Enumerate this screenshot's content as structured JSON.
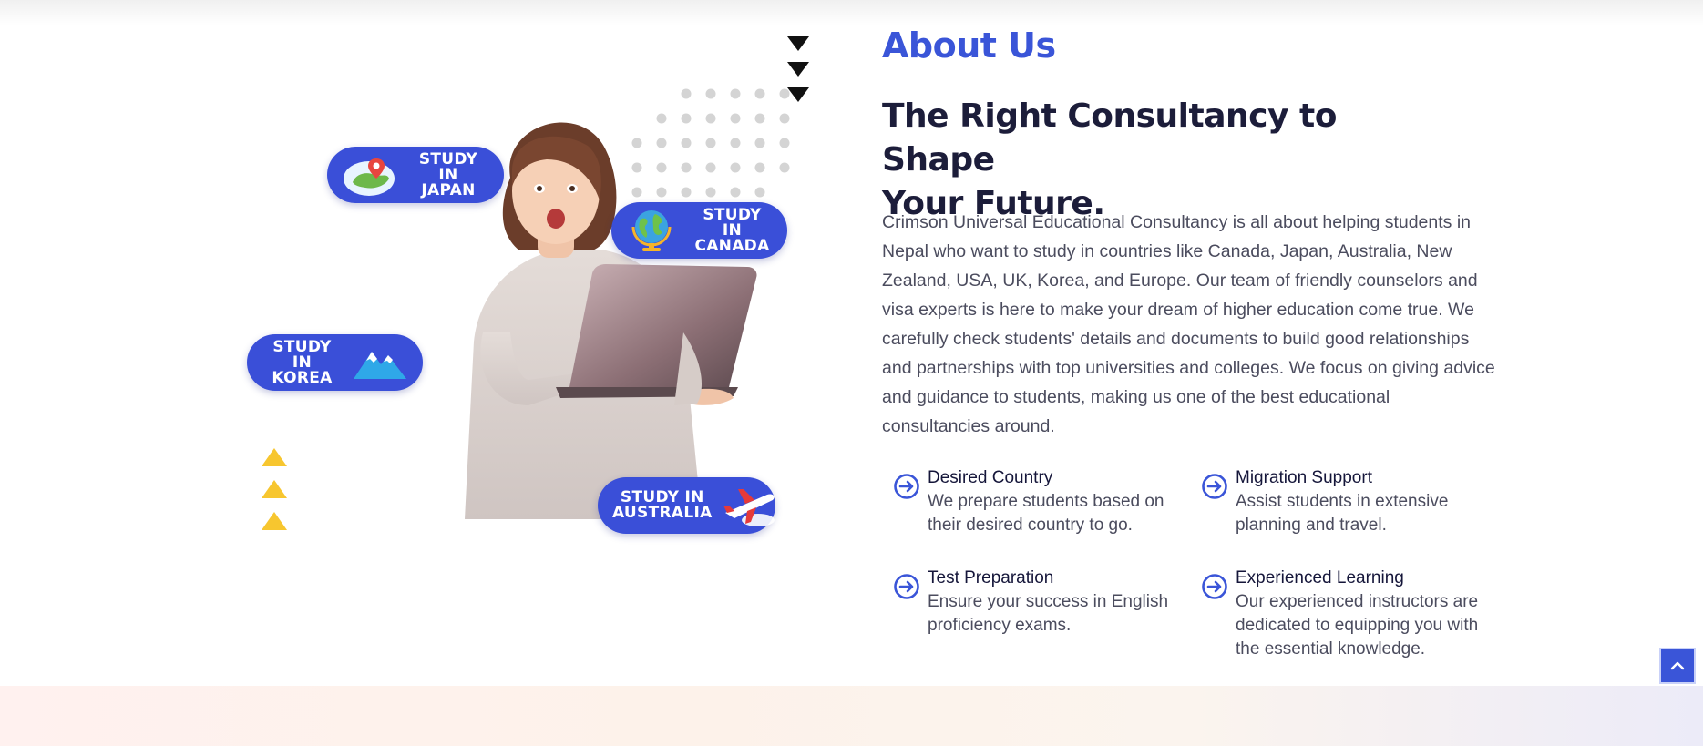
{
  "about": {
    "label": "About Us",
    "headline_line1": "The Right Consultancy to Shape",
    "headline_line2": "Your Future.",
    "description": "Crimson Universal Educational Consultancy is all about helping students in Nepal who want to study in countries like Canada, Japan, Australia, New Zealand, USA, UK, Korea, and Europe. Our team of friendly counselors and visa experts is here to make your dream of higher education come true. We carefully check students' details and documents to build good relationships and partnerships with top universities and colleges. We focus on giving advice and guidance to students, making us one of the best educational consultancies around."
  },
  "features": [
    {
      "title": "Desired Country",
      "description": "We prepare students based on their desired country to go.",
      "icon": "arrow-circle-right-icon"
    },
    {
      "title": "Migration Support",
      "description": "Assist students in extensive planning and travel.",
      "icon": "arrow-circle-right-icon"
    },
    {
      "title": "Test Preparation",
      "description": "Ensure your success in English proficiency exams.",
      "icon": "arrow-circle-right-icon"
    },
    {
      "title": "Experienced Learning",
      "description": "Our experienced instructors are dedicated to equipping you with the essential knowledge.",
      "icon": "arrow-circle-right-icon"
    }
  ],
  "badges": {
    "japan": {
      "line1": "STUDY IN",
      "line2": "JAPAN",
      "icon": "japan-map-icon"
    },
    "canada": {
      "line1": "STUDY IN",
      "line2": "CANADA",
      "icon": "globe-icon"
    },
    "korea": {
      "line1": "STUDY IN",
      "line2": "KOREA",
      "icon": "mountain-icon"
    },
    "australia": {
      "line1": "STUDY IN",
      "line2": "AUSTRALIA",
      "icon": "airplane-icon"
    }
  },
  "scroll_top": {
    "icon": "chevron-up-icon"
  },
  "colors": {
    "accent": "#3a55d8",
    "badge": "#3a4fd8",
    "heading": "#1c1d3a",
    "body_text": "#4b4c5e",
    "yellow_triangles": "#f7c62f",
    "dots": "#d4d4d4"
  }
}
